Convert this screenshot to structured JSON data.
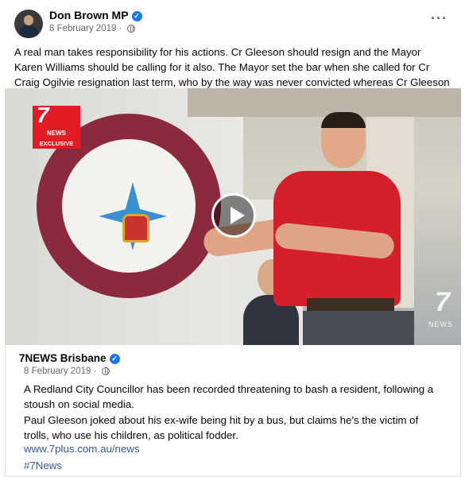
{
  "post": {
    "author": "Don Brown MP",
    "date": "8 February 2019",
    "date_sep": "·",
    "more_label": "···",
    "text": "A real man takes responsibility for his actions. Cr Gleeson should resign and the Mayor Karen Williams should be calling for it also. The Mayor set the bar when she called for Cr Craig Ogilvie resignation last term, who by the way was never convicted whereas Cr Gleeson has been."
  },
  "video": {
    "badge_number": "7",
    "badge_news": "NEWS",
    "badge_exclusive": "EXCLUSIVE",
    "corner_number": "7",
    "corner_news": "NEWS"
  },
  "shared": {
    "author": "7NEWS Brisbane",
    "date": "8 February 2019",
    "date_sep": "·",
    "text1": "A Redland City Councillor has been recorded threatening to bash a resident, following a stoush on social media.",
    "text2": "Paul Gleeson joked about his ex-wife being hit by a bus, but claims he's the victim of trolls, who use his children, as political fodder.",
    "link": "www.7plus.com.au/news",
    "hashtag": "#7News"
  },
  "icons": {
    "verified": "verified-badge-icon",
    "privacy": "globe-icon",
    "play": "play-icon"
  },
  "colors": {
    "accent": "#1877f2",
    "link": "#385898",
    "muted": "#65676b",
    "brand_red": "#e21c24"
  }
}
